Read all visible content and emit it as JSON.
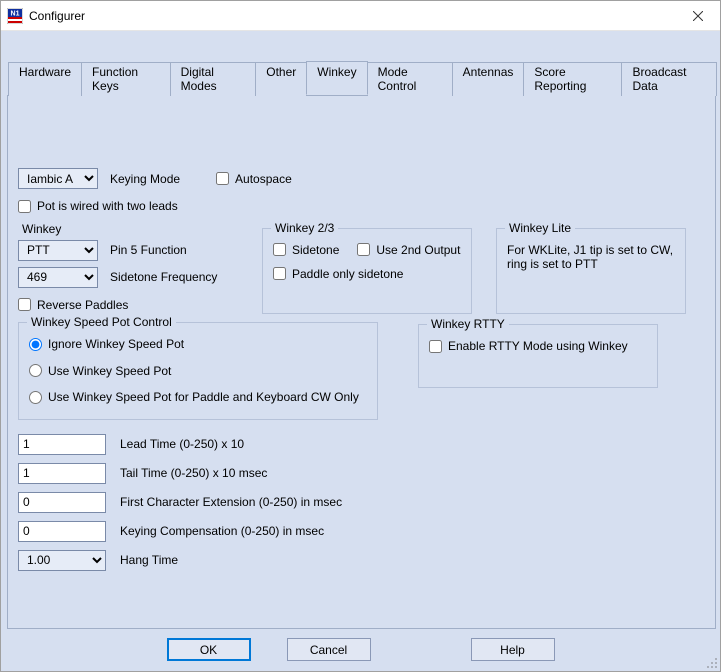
{
  "window": {
    "title": "Configurer"
  },
  "tabs": [
    {
      "label": "Hardware"
    },
    {
      "label": "Function Keys"
    },
    {
      "label": "Digital Modes"
    },
    {
      "label": "Other"
    },
    {
      "label": "Winkey"
    },
    {
      "label": "Mode Control"
    },
    {
      "label": "Antennas"
    },
    {
      "label": "Score Reporting"
    },
    {
      "label": "Broadcast Data"
    }
  ],
  "active_tab": 4,
  "keying": {
    "mode_value": "Iambic A",
    "mode_label": "Keying Mode",
    "autospace": "Autospace",
    "pot_two_leads": "Pot is wired with two leads"
  },
  "winkey": {
    "legend": "Winkey",
    "pin5_value": "PTT",
    "pin5_label": "Pin 5 Function",
    "sidetone_value": "469",
    "sidetone_label": "Sidetone Frequency",
    "reverse_paddles": "Reverse Paddles"
  },
  "winkey23": {
    "legend": "Winkey 2/3",
    "sidetone": "Sidetone",
    "use_2nd": "Use 2nd Output",
    "paddle_only": "Paddle only sidetone"
  },
  "winkey_lite": {
    "legend": "Winkey Lite",
    "line1": "For WKLite, J1 tip is set to CW,",
    "line2": "ring is set to PTT"
  },
  "speed_pot": {
    "legend": "Winkey Speed Pot Control",
    "opt1": "Ignore Winkey Speed Pot",
    "opt2": "Use Winkey Speed Pot",
    "opt3": "Use Winkey Speed Pot for Paddle and Keyboard CW Only"
  },
  "winkey_rtty": {
    "legend": "Winkey RTTY",
    "enable": "Enable RTTY Mode using Winkey"
  },
  "timing": {
    "lead_value": "1",
    "lead_label": "Lead Time (0-250) x 10",
    "tail_value": "1",
    "tail_label": "Tail Time (0-250) x 10 msec",
    "fce_value": "0",
    "fce_label": "First Character Extension (0-250) in msec",
    "comp_value": "0",
    "comp_label": "Keying Compensation (0-250) in msec",
    "hang_value": "1.00",
    "hang_label": "Hang Time"
  },
  "buttons": {
    "ok": "OK",
    "cancel": "Cancel",
    "help": "Help"
  }
}
